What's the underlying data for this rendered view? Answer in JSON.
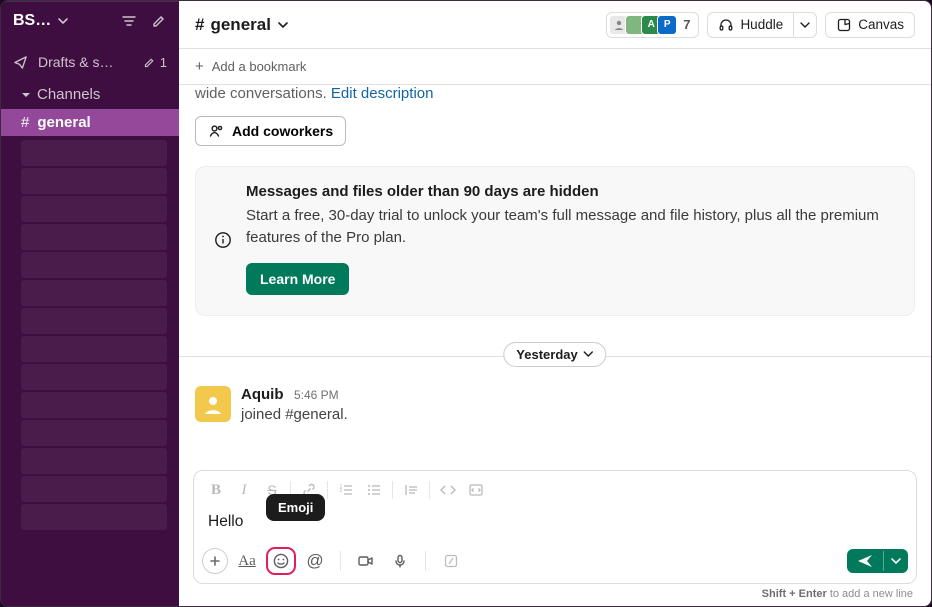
{
  "sidebar": {
    "workspace_name": "BS…",
    "drafts_label": "Drafts & s…",
    "drafts_count": "1",
    "channels_label": "Channels",
    "active_channel": "general"
  },
  "header": {
    "channel_name": "general",
    "avatar_labels": [
      "",
      "A",
      "P",
      "P"
    ],
    "member_count": "7",
    "huddle_label": "Huddle",
    "canvas_label": "Canvas"
  },
  "bookmarks": {
    "add_label": "Add a bookmark"
  },
  "description": {
    "line": "wide conversations. ",
    "link": "Edit description"
  },
  "add_coworkers_label": "Add coworkers",
  "notice": {
    "title": "Messages and files older than 90 days are hidden",
    "body": "Start a free, 30-day trial to unlock your team's full message and file history, plus all the premium features of the Pro plan.",
    "cta": "Learn More"
  },
  "divider_label": "Yesterday",
  "message": {
    "sender": "Aquib",
    "time": "5:46 PM",
    "body": "joined #general."
  },
  "composer": {
    "text": "Hello",
    "tooltip": "Emoji",
    "hint_bold": "Shift + Enter",
    "hint_rest": " to add a new line"
  }
}
